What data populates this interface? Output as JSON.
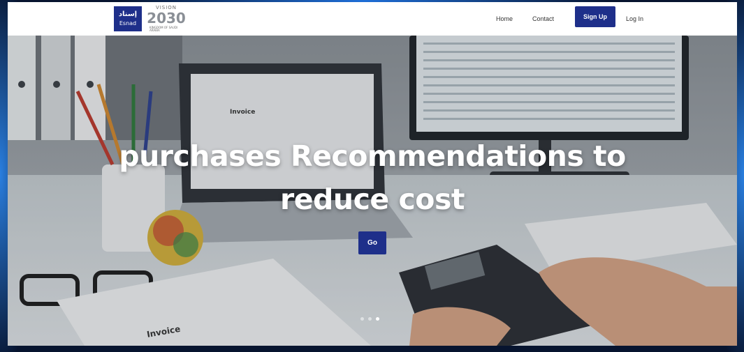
{
  "brand": {
    "esnad_ar": "إسناد",
    "esnad_en": "Esnad",
    "vision_top": "VISION",
    "vision_year": "2030",
    "vision_sub": "KINGDOM OF SAUDI ARABIA"
  },
  "nav": {
    "home": "Home",
    "contact": "Contact",
    "signup": "Sign Up",
    "login": "Log In"
  },
  "hero": {
    "title_line1": "purchases Recommendations to",
    "title_line2": "reduce cost",
    "cta": "Go",
    "slides": 3,
    "active_slide": 3
  },
  "colors": {
    "primary": "#1e2f8a",
    "backdrop": "#07142f"
  },
  "scene": {
    "invoice_text": "Invoice",
    "paper_text": "Invoice"
  }
}
